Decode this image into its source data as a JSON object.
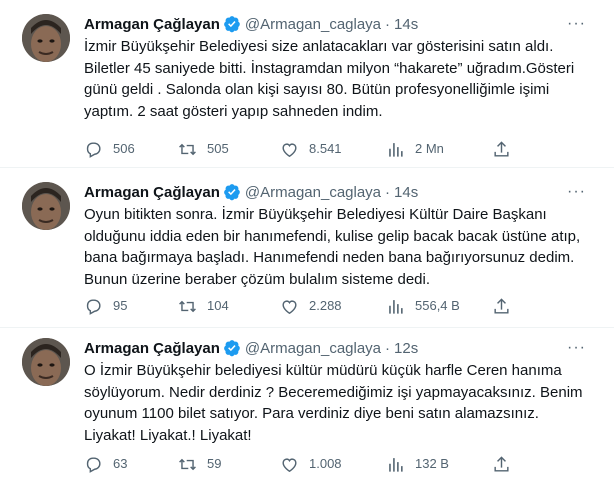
{
  "author": {
    "name": "Armagan Çağlayan"
  },
  "icons": {
    "verified": "verified-badge-icon",
    "reply": "reply-icon",
    "retweet": "retweet-icon",
    "like": "heart-icon",
    "views": "views-bar-chart-icon",
    "share": "share-icon",
    "more": "more-dots-icon"
  },
  "colors": {
    "verified": "#1d9bf0",
    "muted": "#536471",
    "text": "#0f1419",
    "divider": "#eff3f4"
  },
  "tweets": [
    {
      "handle": "@Armagan_caglaya",
      "dot": "·",
      "time": "14s",
      "more": "···",
      "text": "İzmir Büyükşehir Belediyesi size anlatacakları var gösterisini satın aldı. Biletler 45 saniyede bitti. İnstagramdan milyon “hakarete” uğradım.Gösteri günü geldi . Salonda olan kişi sayısı 80. Bütün profesyonelliğimle işimi yaptım. 2 saat gösteri yapıp sahneden indim.",
      "replies": "506",
      "retweets": "505",
      "likes": "8.541",
      "views": "2 Mn"
    },
    {
      "handle": "@Armagan_caglaya",
      "dot": "·",
      "time": "14s",
      "more": "···",
      "text": "Oyun bitikten sonra. İzmir Büyükşehir Belediyesi Kültür Daire Başkanı olduğunu iddia eden bir hanımefendi, kulise gelip bacak bacak üstüne atıp, bana bağırmaya başladı. Hanımefendi neden bana bağırıyorsunuz dedim. Bunun üzerine beraber çözüm bulalım sisteme dedi.",
      "replies": "95",
      "retweets": "104",
      "likes": "2.288",
      "views": "556,4 B"
    },
    {
      "handle": "@Armagan_caglaya",
      "dot": "·",
      "time": "12s",
      "more": "···",
      "text": "O İzmir Büyükşehir belediyesi kültür müdürü küçük harfle Ceren hanıma söylüyorum. Nedir derdiniz ? Beceremediğimiz işi yapmayacaksınız. Benim oyunum 1100 bilet satıyor. Para verdiniz diye beni satın alamazsınız. Liyakat! Liyakat.! Liyakat!",
      "replies": "63",
      "retweets": "59",
      "likes": "1.008",
      "views": "132 B"
    }
  ]
}
